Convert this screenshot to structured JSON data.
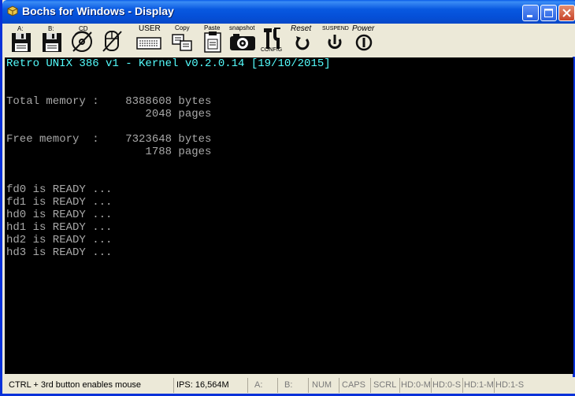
{
  "window": {
    "title": "Bochs for Windows - Display",
    "icon": "bochs-app-icon"
  },
  "toolbar": {
    "floppy_a_label": "A:",
    "floppy_b_label": "B:",
    "cd_label": "CD",
    "user_label": "USER",
    "copy_label": "Copy",
    "paste_label": "Paste",
    "snapshot_label": "snapshot",
    "config_label": "CONFIG",
    "reset_label": "Reset",
    "suspend_label": "SUSPEND",
    "power_label": "Power"
  },
  "console": {
    "lines": [
      "Retro UNIX 386 v1 - Kernel v0.2.0.14 [19/10/2015]",
      "",
      "",
      "Total memory :    8388608 bytes",
      "                     2048 pages",
      "",
      "Free memory  :    7323648 bytes",
      "                     1788 pages",
      "",
      "",
      "fd0 is READY ...",
      "fd1 is READY ...",
      "hd0 is READY ...",
      "hd1 is READY ...",
      "hd2 is READY ...",
      "hd3 is READY ..."
    ],
    "header_color": "#54fcfc",
    "text_color": "#a8a8a8"
  },
  "status": {
    "message": "CTRL + 3rd button enables mouse",
    "ips": "IPS: 16,564M",
    "a": "A:",
    "b": "B:",
    "num": "NUM",
    "caps": "CAPS",
    "scrl": "SCRL",
    "hd00": "HD:0-M",
    "hd0s": "HD:0-S",
    "hd1m": "HD:1-M",
    "hd1s": "HD:1-S"
  }
}
